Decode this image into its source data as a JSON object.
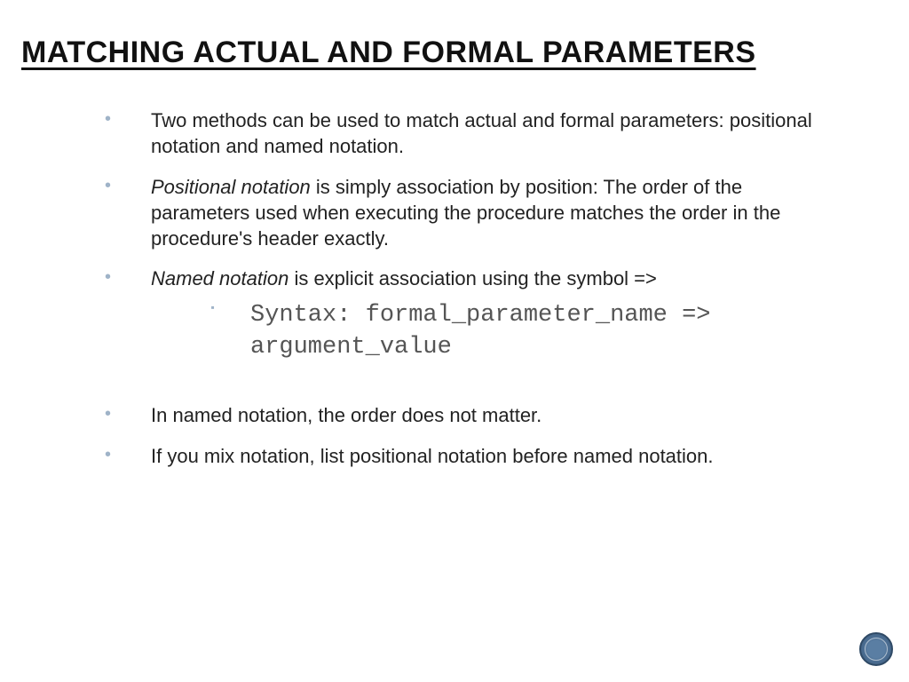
{
  "title": "MATCHING ACTUAL AND FORMAL PARAMETERS",
  "bullets": [
    {
      "text": "Two methods can be used to match actual and formal parameters: positional notation and named notation."
    },
    {
      "lead": "Positional notation",
      "rest": " is simply association by position: The order of the parameters used when executing the procedure matches the order in the procedure's header exactly."
    },
    {
      "lead": "Named notation",
      "rest": " is explicit association using the symbol =>",
      "sub": "Syntax: formal_parameter_name => argument_value"
    },
    {
      "text": "In named notation, the order does not matter."
    },
    {
      "text": "If you mix notation, list positional notation before named notation."
    }
  ]
}
